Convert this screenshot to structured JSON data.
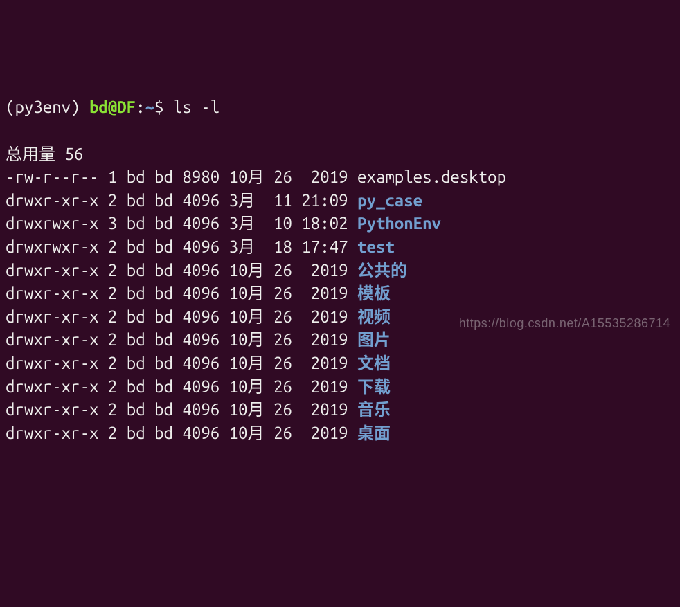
{
  "prompt": {
    "env": "(py3env) ",
    "user_host": "bd@DF",
    "colon": ":",
    "path": "~",
    "dollar": "$ ",
    "command": "ls -l"
  },
  "total_line": "总用量 56",
  "rows": [
    {
      "perm": "-rw-r--r--",
      "links": "1",
      "owner": "bd",
      "group": "bd",
      "size": "8980",
      "month": "10月",
      "day": "26",
      "time": " 2019",
      "name": "examples.desktop",
      "type": "file"
    },
    {
      "perm": "drwxr-xr-x",
      "links": "2",
      "owner": "bd",
      "group": "bd",
      "size": "4096",
      "month": "3月 ",
      "day": "11",
      "time": "21:09",
      "name": "py_case",
      "type": "dir"
    },
    {
      "perm": "drwxrwxr-x",
      "links": "3",
      "owner": "bd",
      "group": "bd",
      "size": "4096",
      "month": "3月 ",
      "day": "10",
      "time": "18:02",
      "name": "PythonEnv",
      "type": "dir"
    },
    {
      "perm": "drwxrwxr-x",
      "links": "2",
      "owner": "bd",
      "group": "bd",
      "size": "4096",
      "month": "3月 ",
      "day": "18",
      "time": "17:47",
      "name": "test",
      "type": "dir"
    },
    {
      "perm": "drwxr-xr-x",
      "links": "2",
      "owner": "bd",
      "group": "bd",
      "size": "4096",
      "month": "10月",
      "day": "26",
      "time": " 2019",
      "name": "公共的",
      "type": "dir"
    },
    {
      "perm": "drwxr-xr-x",
      "links": "2",
      "owner": "bd",
      "group": "bd",
      "size": "4096",
      "month": "10月",
      "day": "26",
      "time": " 2019",
      "name": "模板",
      "type": "dir"
    },
    {
      "perm": "drwxr-xr-x",
      "links": "2",
      "owner": "bd",
      "group": "bd",
      "size": "4096",
      "month": "10月",
      "day": "26",
      "time": " 2019",
      "name": "视频",
      "type": "dir"
    },
    {
      "perm": "drwxr-xr-x",
      "links": "2",
      "owner": "bd",
      "group": "bd",
      "size": "4096",
      "month": "10月",
      "day": "26",
      "time": " 2019",
      "name": "图片",
      "type": "dir"
    },
    {
      "perm": "drwxr-xr-x",
      "links": "2",
      "owner": "bd",
      "group": "bd",
      "size": "4096",
      "month": "10月",
      "day": "26",
      "time": " 2019",
      "name": "文档",
      "type": "dir"
    },
    {
      "perm": "drwxr-xr-x",
      "links": "2",
      "owner": "bd",
      "group": "bd",
      "size": "4096",
      "month": "10月",
      "day": "26",
      "time": " 2019",
      "name": "下载",
      "type": "dir"
    },
    {
      "perm": "drwxr-xr-x",
      "links": "2",
      "owner": "bd",
      "group": "bd",
      "size": "4096",
      "month": "10月",
      "day": "26",
      "time": " 2019",
      "name": "音乐",
      "type": "dir"
    },
    {
      "perm": "drwxr-xr-x",
      "links": "2",
      "owner": "bd",
      "group": "bd",
      "size": "4096",
      "month": "10月",
      "day": "26",
      "time": " 2019",
      "name": "桌面",
      "type": "dir"
    }
  ],
  "watermark": "https://blog.csdn.net/A15535286714"
}
